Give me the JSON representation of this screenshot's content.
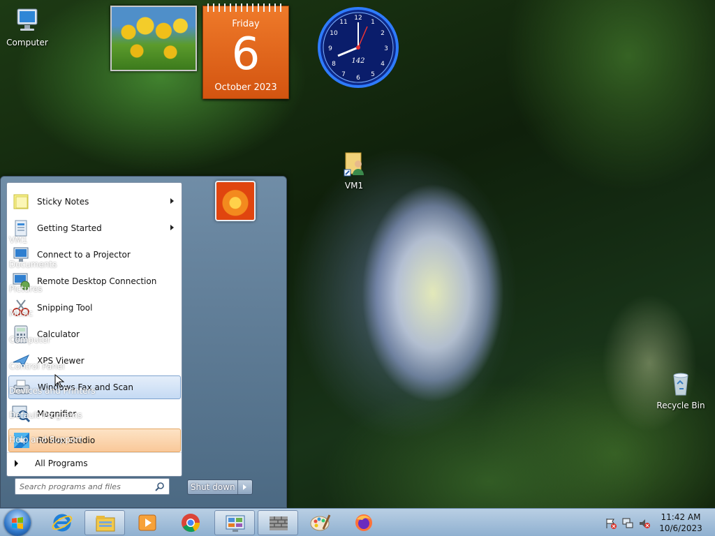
{
  "desktop": {
    "icons": [
      {
        "label": "Computer",
        "icon": "computer-icon"
      },
      {
        "label": "VM1",
        "icon": "user-folder-shortcut-icon"
      },
      {
        "label": "Recycle Bin",
        "icon": "recycle-bin-icon"
      }
    ]
  },
  "gadgets": {
    "calendar": {
      "weekday": "Friday",
      "day": "6",
      "month_year": "October 2023"
    },
    "clock": {
      "label": "142"
    }
  },
  "start_menu": {
    "programs": [
      {
        "label": "Sticky Notes",
        "icon": "sticky-notes-icon",
        "submenu": true
      },
      {
        "label": "Getting Started",
        "icon": "getting-started-icon",
        "submenu": true
      },
      {
        "label": "Connect to a Projector",
        "icon": "projector-icon"
      },
      {
        "label": "Remote Desktop Connection",
        "icon": "remote-desktop-icon"
      },
      {
        "label": "Snipping Tool",
        "icon": "scissors-icon"
      },
      {
        "label": "Calculator",
        "icon": "calculator-icon"
      },
      {
        "label": "XPS Viewer",
        "icon": "xps-viewer-icon"
      },
      {
        "label": "Windows Fax and Scan",
        "icon": "fax-icon",
        "highlighted": true
      },
      {
        "label": "Magnifier",
        "icon": "magnifier-icon"
      },
      {
        "label": "Roblox Studio",
        "icon": "roblox-studio-icon",
        "new": true
      }
    ],
    "all_programs": "All Programs",
    "search_placeholder": "Search programs and files",
    "right_links": [
      "VM1",
      "Documents",
      "Pictures",
      "Music",
      "Computer",
      "Control Panel",
      "Devices and Printers",
      "Default Programs",
      "Help and Support"
    ],
    "shutdown_label": "Shut down"
  },
  "taskbar": {
    "pinned": [
      {
        "icon": "internet-explorer-icon"
      },
      {
        "icon": "file-explorer-icon",
        "open": true
      },
      {
        "icon": "media-player-icon"
      },
      {
        "icon": "chrome-icon"
      },
      {
        "icon": "control-panel-icon",
        "open": true
      },
      {
        "icon": "firewall-icon",
        "open": true
      },
      {
        "icon": "paint-icon"
      },
      {
        "icon": "firefox-icon"
      }
    ],
    "tray": {
      "time": "11:42 AM",
      "date": "10/6/2023"
    }
  },
  "colors": {
    "calendar": "#e0641c",
    "new_program": "#f9c899",
    "highlight": "#c5daf3"
  }
}
